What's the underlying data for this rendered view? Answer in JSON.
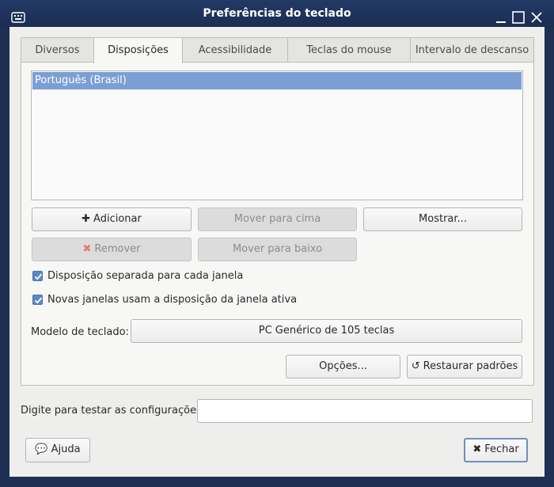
{
  "window": {
    "title": "Preferências do teclado"
  },
  "tabs": [
    {
      "label": "Diversos"
    },
    {
      "label": "Disposições"
    },
    {
      "label": "Acessibilidade"
    },
    {
      "label": "Teclas do mouse"
    },
    {
      "label": "Intervalo de descanso"
    }
  ],
  "layouts": {
    "items": [
      "Português (Brasil)"
    ]
  },
  "buttons": {
    "add": "Adicionar",
    "move_up": "Mover para cima",
    "show": "Mostrar...",
    "remove": "Remover",
    "move_down": "Mover para baixo",
    "options": "Opções...",
    "reset": "Restaurar padrões",
    "help": "Ajuda",
    "close": "Fechar"
  },
  "checkboxes": {
    "separate_layout": "Disposição separada para cada janela",
    "new_windows": "Novas janelas usam a disposição da janela ativa"
  },
  "keyboard_model": {
    "label": "Modelo de teclado:",
    "value": "PC Genérico de 105 teclas"
  },
  "test": {
    "label": "Digite para testar as configurações:",
    "value": ""
  },
  "colors": {
    "selection": "#7b9fd3",
    "remove_icon": "#e07b6e",
    "titlebar": "#1e2f54"
  }
}
